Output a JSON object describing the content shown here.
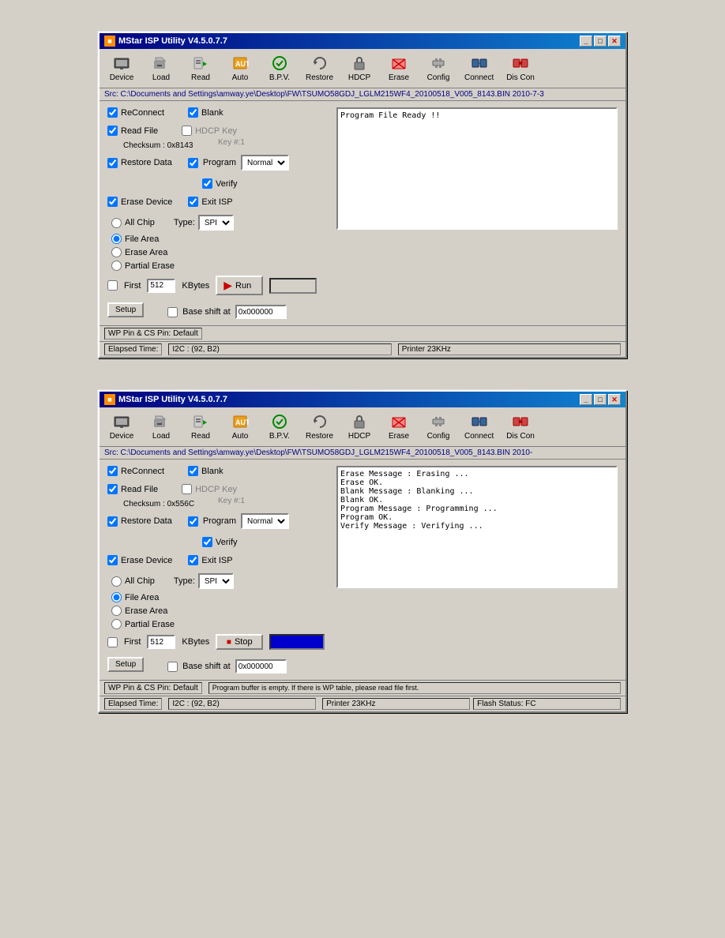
{
  "window1": {
    "title": "MStar ISP Utility V4.5.0.7.7",
    "src_path": "Src: C:\\Documents and Settings\\amway.ye\\Desktop\\FW\\TSUMO58GDJ_LGLM215WF4_20100518_V005_8143.BIN 2010-7-3",
    "toolbar": {
      "device": "Device",
      "load": "Load",
      "read": "Read",
      "auto": "Auto",
      "bpv": "B.P.V.",
      "restore": "Restore",
      "hdcp": "HDCP",
      "erase": "Erase",
      "config": "Config",
      "connect": "Connect",
      "discon": "Dis Con"
    },
    "reconnect_label": "ReConnect",
    "blank_label": "Blank",
    "read_file_label": "Read File",
    "hdcp_key_label": "HDCP Key",
    "checksum_label": "Checksum : 0x8143",
    "key_label": "Key #:1",
    "restore_data_label": "Restore Data",
    "program_label": "Program",
    "program_value": "Normal",
    "verify_label": "Verify",
    "erase_device_label": "Erase Device",
    "exit_isp_label": "Exit ISP",
    "all_chip_label": "All Chip",
    "type_label": "Type:",
    "type_value": "SPI",
    "file_area_label": "File Area",
    "erase_area_label": "Erase Area",
    "partial_erase_label": "Partial Erase",
    "first_label": "First",
    "first_value": "512",
    "kbytes_label": "KBytes",
    "run_label": "Run",
    "setup_label": "Setup",
    "base_shift_label": "Base shift at",
    "base_shift_value": "0x000000",
    "log_text": "Program File Ready !!",
    "wp_status": "WP Pin & CS Pin: Default",
    "elapsed_label": "Elapsed Time:",
    "i2c_status": "I2C : (92, B2)",
    "printer_status": "Printer  23KHz"
  },
  "window2": {
    "title": "MStar ISP Utility V4.5.0.7.7",
    "src_path": "Src: C:\\Documents and Settings\\amway.ye\\Desktop\\FW\\TSUMO58GDJ_LGLM215WF4_20100518_V005_8143.BIN 2010-",
    "toolbar": {
      "device": "Device",
      "load": "Load",
      "read": "Read",
      "auto": "Auto",
      "bpv": "B.P.V.",
      "restore": "Restore",
      "hdcp": "HDCP",
      "erase": "Erase",
      "config": "Config",
      "connect": "Connect",
      "discon": "Dis Con"
    },
    "reconnect_label": "ReConnect",
    "blank_label": "Blank",
    "read_file_label": "Read File",
    "hdcp_key_label": "HDCP Key",
    "checksum_label": "Checksum : 0x556C",
    "key_label": "Key #:1",
    "restore_data_label": "Restore Data",
    "program_label": "Program",
    "program_value": "Normal",
    "verify_label": "Verify",
    "erase_device_label": "Erase Device",
    "exit_isp_label": "Exit ISP",
    "all_chip_label": "All Chip",
    "type_label": "Type:",
    "type_value": "SPI",
    "file_area_label": "File Area",
    "erase_area_label": "Erase Area",
    "partial_erase_label": "Partial Erase",
    "first_label": "First",
    "first_value": "512",
    "kbytes_label": "KBytes",
    "stop_label": "Stop",
    "setup_label": "Setup",
    "base_shift_label": "Base shift at",
    "base_shift_value": "0x000000",
    "log_lines": [
      "Erase Message : Erasing ...",
      "Erase OK.",
      "Blank Message : Blanking ...",
      "Blank OK.",
      "Program Message : Programming ...",
      "Program OK.",
      "Verify Message : Verifying ..."
    ],
    "wp_status": "WP Pin & CS Pin: Default",
    "warn_status": "Program buffer is empty. If there is WP table, please read file first.",
    "elapsed_label": "Elapsed Time:",
    "i2c_status": "I2C : (92, B2)",
    "printer_status": "Printer  23KHz",
    "flash_status": "Flash Status: FC"
  }
}
